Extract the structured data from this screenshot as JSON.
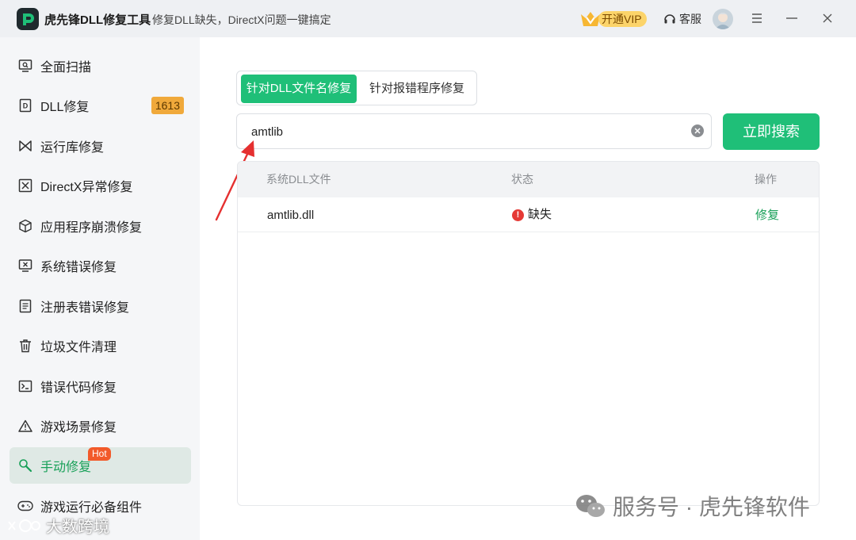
{
  "titlebar": {
    "app_title": "虎先锋DLL修复工具",
    "subtitle": "修复DLL缺失，DirectX问题一键搞定",
    "vip_label": "开通VIP",
    "service_label": "客服"
  },
  "sidebar": {
    "items": [
      {
        "label": "全面扫描",
        "icon": "monitor-scan-icon"
      },
      {
        "label": "DLL修复",
        "icon": "dll-file-icon",
        "badge": "1613"
      },
      {
        "label": "运行库修复",
        "icon": "bowtie-icon"
      },
      {
        "label": "DirectX异常修复",
        "icon": "x-box-icon"
      },
      {
        "label": "应用程序崩溃修复",
        "icon": "cube-icon"
      },
      {
        "label": "系统错误修复",
        "icon": "monitor-x-icon"
      },
      {
        "label": "注册表错误修复",
        "icon": "document-icon"
      },
      {
        "label": "垃圾文件清理",
        "icon": "trash-icon"
      },
      {
        "label": "错误代码修复",
        "icon": "terminal-icon"
      },
      {
        "label": "游戏场景修复",
        "icon": "warning-icon"
      },
      {
        "label": "手动修复",
        "icon": "wrench-icon",
        "hot": "Hot"
      },
      {
        "label": "游戏运行必备组件",
        "icon": "gamepad-icon"
      }
    ]
  },
  "tabs": {
    "tab1": "针对DLL文件名修复",
    "tab2": "针对报错程序修复"
  },
  "search": {
    "value": "amtlib",
    "button": "立即搜索"
  },
  "table": {
    "headers": [
      "系统DLL文件",
      "状态",
      "操作"
    ],
    "rows": [
      {
        "file": "amtlib.dll",
        "status": "缺失",
        "action": "修复"
      }
    ]
  },
  "watermark": {
    "text": "服务号 · 虎先锋软件",
    "text2": "大数跨境"
  },
  "colors": {
    "accent": "#1fbf78",
    "badge": "#f0a93b",
    "hot": "#f25a2a",
    "missing": "#e53935"
  }
}
